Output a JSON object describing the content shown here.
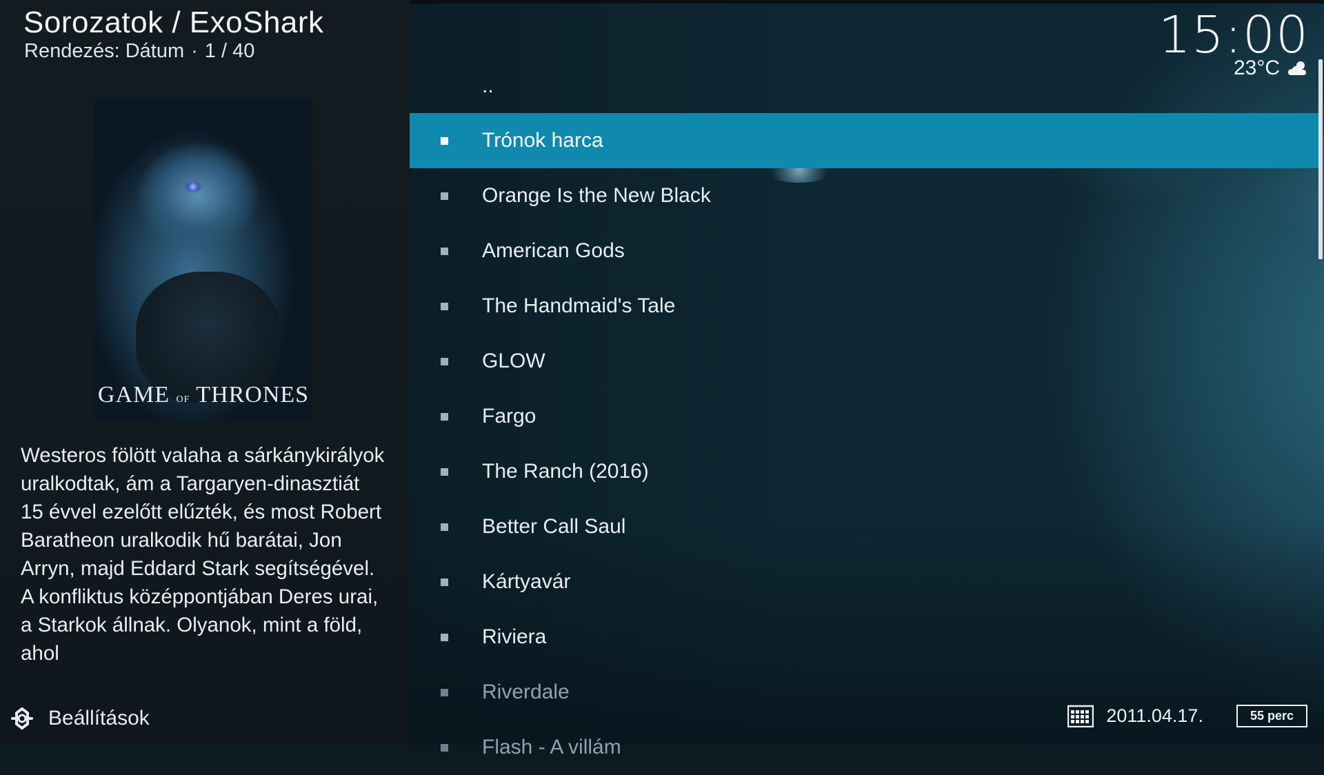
{
  "header": {
    "title": "Sorozatok / ExoShark",
    "sort_label": "Rendezés: Dátum",
    "sort_separator": "·",
    "position": "1 / 40"
  },
  "poster": {
    "logo_text_1": "GAME",
    "logo_text_2": "OF",
    "logo_text_3": "THRONES"
  },
  "plot": "Westeros fölött valaha a sárkánykirályok uralkodtak, ám a Targaryen-dinasztiát 15 évvel ezelőtt elűzték, és most Robert Baratheon uralkodik hű barátai, Jon Arryn, majd Eddard Stark segítségével. A konfliktus középpontjában Deres urai, a Starkok állnak. Olyanok, mint a föld, ahol",
  "settings": {
    "label": "Beállítások",
    "icon": "gear-icon"
  },
  "list": {
    "parent": "..",
    "items": [
      "Trónok harca",
      "Orange Is the New Black",
      "American Gods",
      "The Handmaid's Tale",
      "GLOW",
      "Fargo",
      "The Ranch (2016)",
      "Better Call Saul",
      "Kártyavár",
      "Riviera",
      "Riverdale",
      "Flash - A villám"
    ],
    "selected_index": 0
  },
  "clock": {
    "time": "15:00"
  },
  "weather": {
    "temperature": "23°C",
    "icon": "partly-cloudy-icon"
  },
  "info": {
    "date": "2011.04.17.",
    "runtime": "55 perc",
    "date_icon": "calendar-icon"
  },
  "colors": {
    "accent": "#0f89ad",
    "panel": "#131b20"
  }
}
